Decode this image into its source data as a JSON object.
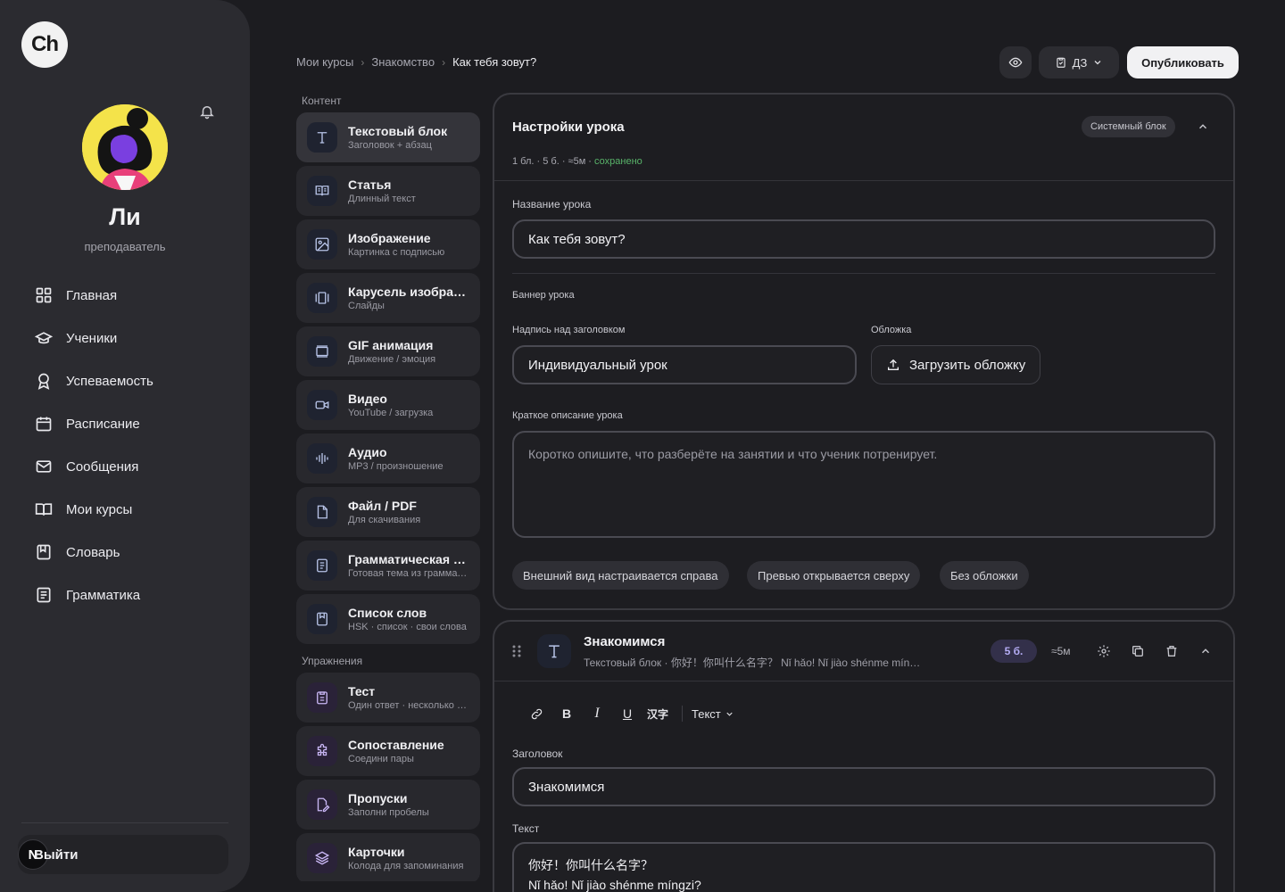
{
  "app": {
    "logo": "Ch"
  },
  "user": {
    "name": "Ли",
    "role": "преподаватель"
  },
  "nav": [
    {
      "label": "Главная",
      "icon": "grid-icon"
    },
    {
      "label": "Ученики",
      "icon": "graduation-cap-icon"
    },
    {
      "label": "Успеваемость",
      "icon": "award-icon"
    },
    {
      "label": "Расписание",
      "icon": "calendar-icon"
    },
    {
      "label": "Сообщения",
      "icon": "mail-icon"
    },
    {
      "label": "Мои курсы",
      "icon": "book-open-icon"
    },
    {
      "label": "Словарь",
      "icon": "dictionary-icon"
    },
    {
      "label": "Грамматика",
      "icon": "notebook-icon"
    }
  ],
  "logout": {
    "badge": "N",
    "label": "Выйти"
  },
  "breadcrumb": [
    "Мои курсы",
    "Знакомство",
    "Как тебя зовут?"
  ],
  "header": {
    "homework_label": "ДЗ",
    "publish_label": "Опубликовать"
  },
  "palette": {
    "content_label": "Контент",
    "content": [
      {
        "title": "Текстовый блок",
        "sub": "Заголовок + абзац",
        "icon": "text-icon"
      },
      {
        "title": "Статья",
        "sub": "Длинный текст",
        "icon": "article-icon"
      },
      {
        "title": "Изображение",
        "sub": "Картинка с подписью",
        "icon": "image-icon"
      },
      {
        "title": "Карусель изображений",
        "sub": "Слайды",
        "icon": "carousel-icon"
      },
      {
        "title": "GIF анимация",
        "sub": "Движение / эмоция",
        "icon": "gif-icon"
      },
      {
        "title": "Видео",
        "sub": "YouTube / загрузка",
        "icon": "video-icon"
      },
      {
        "title": "Аудио",
        "sub": "MP3 / произношение",
        "icon": "audio-icon"
      },
      {
        "title": "Файл / PDF",
        "sub": "Для скачивания",
        "icon": "file-icon"
      },
      {
        "title": "Грамматическая тема",
        "sub": "Готовая тема из грамматики",
        "icon": "grammar-icon"
      },
      {
        "title": "Список слов",
        "sub": "HSK · список · свои слова",
        "icon": "wordlist-icon"
      }
    ],
    "exercises_label": "Упражнения",
    "exercises": [
      {
        "title": "Тест",
        "sub": "Один ответ · несколько ответов",
        "icon": "quiz-icon"
      },
      {
        "title": "Сопоставление",
        "sub": "Соедини пары",
        "icon": "puzzle-icon"
      },
      {
        "title": "Пропуски",
        "sub": "Заполни пробелы",
        "icon": "gaps-icon"
      },
      {
        "title": "Карточки",
        "sub": "Колода для запоминания",
        "icon": "cards-icon"
      }
    ]
  },
  "settings": {
    "title": "Настройки урока",
    "badge": "Системный блок",
    "meta": "1 бл. · 5 б. · ≈5м · ",
    "meta_status": "сохранено",
    "name_label": "Название урока",
    "name_value": "Как тебя зовут?",
    "banner_label": "Баннер урока",
    "over_title_label": "Надпись над заголовком",
    "over_title_value": "Индивидуальный урок",
    "cover_label": "Обложка",
    "upload_label": "Загрузить обложку",
    "desc_label": "Краткое описание урока",
    "desc_placeholder": "Коротко опишите, что разберёте на занятии и что ученик потренирует.",
    "chips": [
      "Внешний вид настраивается справа",
      "Превью открывается сверху",
      "Без обложки"
    ]
  },
  "block": {
    "title": "Знакомимся",
    "sub": "Текстовый блок · 你好！你叫什么名字？ Nǐ hǎo! Nǐ jiào shénme míngzi?",
    "score": "5 б.",
    "duration": "≈5м",
    "toolbar": {
      "hanzi": "汉字",
      "format": "Текст"
    },
    "heading_label": "Заголовок",
    "heading_value": "Знакомимся",
    "text_label": "Текст",
    "text_value": "你好！你叫什么名字？",
    "text_value_2": "Nǐ hǎo! Nǐ jiào shénme míngzi?"
  },
  "colors": {
    "accent": "#b5adf5",
    "saved": "#59b46a",
    "avatar_bg": "#f4e34a"
  }
}
